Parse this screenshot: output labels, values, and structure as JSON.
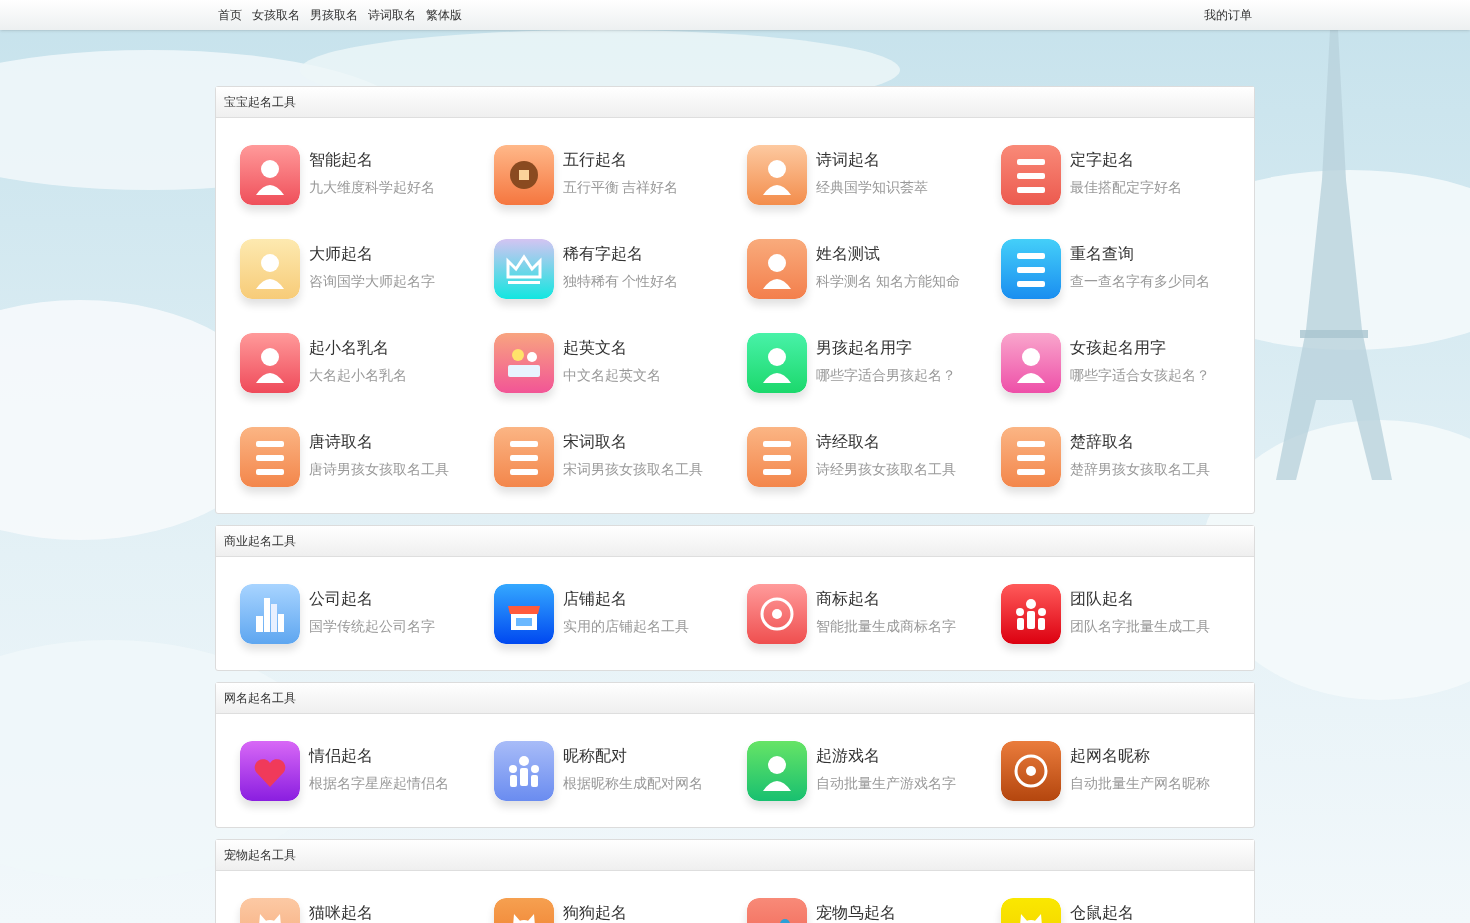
{
  "nav": {
    "links": [
      "首页",
      "女孩取名",
      "男孩取名",
      "诗词取名",
      "繁体版"
    ],
    "right_link": "我的订单"
  },
  "sections": [
    {
      "title": "宝宝起名工具",
      "tools": [
        {
          "title": "智能起名",
          "subtitle": "九大维度科学起好名"
        },
        {
          "title": "五行起名",
          "subtitle": "五行平衡 吉祥好名"
        },
        {
          "title": "诗词起名",
          "subtitle": "经典国学知识荟萃"
        },
        {
          "title": "定字起名",
          "subtitle": "最佳搭配定字好名"
        },
        {
          "title": "大师起名",
          "subtitle": "咨询国学大师起名字"
        },
        {
          "title": "稀有字起名",
          "subtitle": "独特稀有 个性好名"
        },
        {
          "title": "姓名测试",
          "subtitle": "科学测名 知名方能知命"
        },
        {
          "title": "重名查询",
          "subtitle": "查一查名字有多少同名"
        },
        {
          "title": "起小名乳名",
          "subtitle": "大名起小名乳名"
        },
        {
          "title": "起英文名",
          "subtitle": "中文名起英文名"
        },
        {
          "title": "男孩起名用字",
          "subtitle": "哪些字适合男孩起名？"
        },
        {
          "title": "女孩起名用字",
          "subtitle": "哪些字适合女孩起名？"
        },
        {
          "title": "唐诗取名",
          "subtitle": "唐诗男孩女孩取名工具"
        },
        {
          "title": "宋词取名",
          "subtitle": "宋词男孩女孩取名工具"
        },
        {
          "title": "诗经取名",
          "subtitle": "诗经男孩女孩取名工具"
        },
        {
          "title": "楚辞取名",
          "subtitle": "楚辞男孩女孩取名工具"
        }
      ]
    },
    {
      "title": "商业起名工具",
      "tools": [
        {
          "title": "公司起名",
          "subtitle": "国学传统起公司名字"
        },
        {
          "title": "店铺起名",
          "subtitle": "实用的店铺起名工具"
        },
        {
          "title": "商标起名",
          "subtitle": "智能批量生成商标名字"
        },
        {
          "title": "团队起名",
          "subtitle": "团队名字批量生成工具"
        }
      ]
    },
    {
      "title": "网名起名工具",
      "tools": [
        {
          "title": "情侣起名",
          "subtitle": "根据名字星座起情侣名"
        },
        {
          "title": "昵称配对",
          "subtitle": "根据昵称生成配对网名"
        },
        {
          "title": "起游戏名",
          "subtitle": "自动批量生产游戏名字"
        },
        {
          "title": "起网名昵称",
          "subtitle": "自动批量生产网名昵称"
        }
      ]
    },
    {
      "title": "宠物起名工具",
      "tools": [
        {
          "title": "猫咪起名"
        },
        {
          "title": "狗狗起名"
        },
        {
          "title": "宠物鸟起名"
        },
        {
          "title": "仓鼠起名"
        }
      ]
    }
  ]
}
